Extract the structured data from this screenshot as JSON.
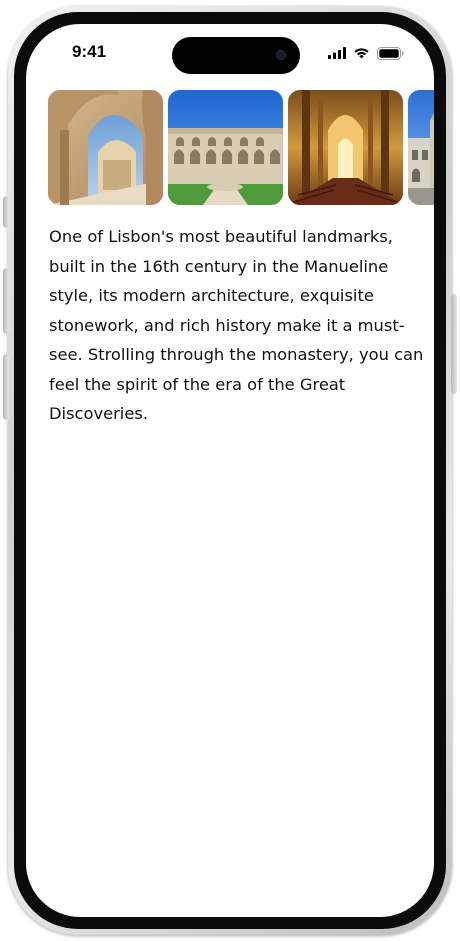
{
  "status_bar": {
    "time": "9:41",
    "icons": [
      "cellular-signal-icon",
      "wifi-icon",
      "battery-icon"
    ]
  },
  "gallery": {
    "images": [
      {
        "name": "cloister-arches-photo"
      },
      {
        "name": "cloister-courtyard-photo"
      },
      {
        "name": "church-nave-photo"
      },
      {
        "name": "monastery-facade-photo"
      }
    ]
  },
  "content": {
    "description": "One of Lisbon's most beautiful landmarks, built in the 16th century in the Manueline style, its modern architecture, exquisite stonework, and rich history make it a must-see. Strolling through the monastery, you can feel the spirit of the era of the Great Discoveries."
  },
  "colors": {
    "text": "#111111",
    "background": "#ffffff",
    "frame": "#d4d4d4",
    "bezel": "#0b0b0b"
  }
}
